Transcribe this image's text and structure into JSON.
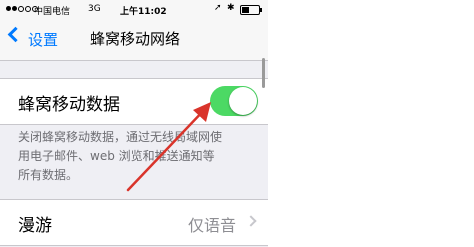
{
  "status_bar": {
    "carrier": "中国电信",
    "network": "3G",
    "time": "上午11:02"
  },
  "nav": {
    "back_label": "设置",
    "title": "蜂窝移动网络"
  },
  "cellular_data": {
    "label": "蜂窝移动数据",
    "enabled": true,
    "toggle_color": "#4cd964"
  },
  "description": {
    "line1": "关闭蜂窝移动数据，通过无线局域网使",
    "line2": "用电子邮件、web 浏览和推送通知等",
    "line3": "所有数据。"
  },
  "roaming": {
    "label": "漫游",
    "value": "仅语音"
  },
  "colors": {
    "accent": "#007aff",
    "annotation_arrow": "#d9342b"
  }
}
